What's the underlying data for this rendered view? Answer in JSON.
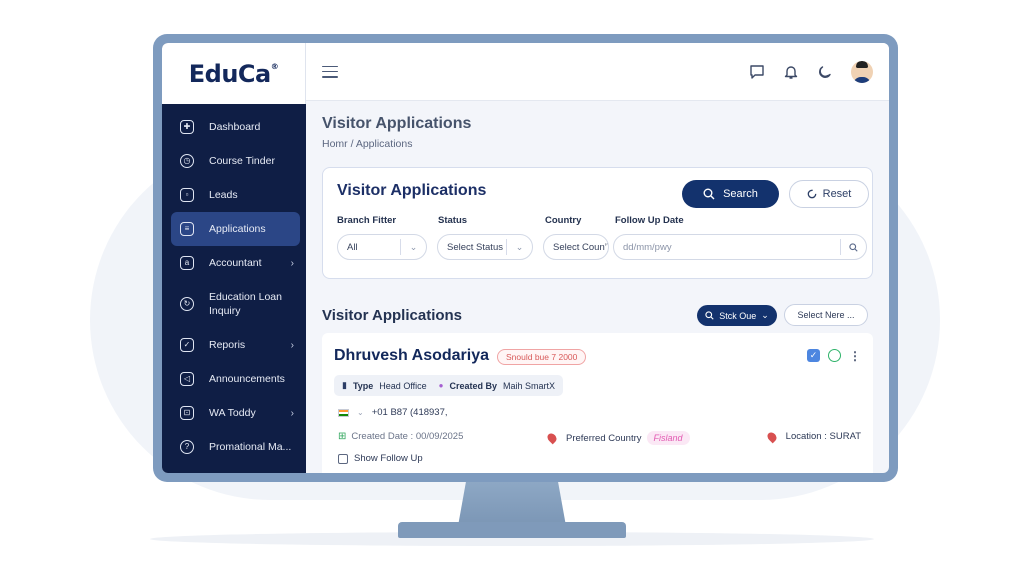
{
  "brand": {
    "logo": "EduCa",
    "logo_mark": "®"
  },
  "sidebar": {
    "items": [
      {
        "label": "Dashboard",
        "icon": "dashboard-icon"
      },
      {
        "label": "Course Tinder",
        "icon": "clock-icon"
      },
      {
        "label": "Leads",
        "icon": "leads-icon"
      },
      {
        "label": "Applications",
        "icon": "applications-icon",
        "active": true
      },
      {
        "label": "Accountant",
        "icon": "accountant-icon",
        "chevron": "›"
      },
      {
        "label": "Education Loan Inquiry",
        "icon": "loan-icon"
      },
      {
        "label": "Reporis",
        "icon": "reports-icon",
        "chevron": "›"
      },
      {
        "label": "Announcements",
        "icon": "megaphone-icon"
      },
      {
        "label": "WA Toddy",
        "icon": "wa-icon",
        "chevron": "›"
      },
      {
        "label": "Promational Ma...",
        "icon": "promotion-icon"
      }
    ]
  },
  "header": {
    "icons": [
      "chat-icon",
      "bell-icon",
      "moon-icon",
      "avatar"
    ]
  },
  "page": {
    "title": "Visitor Applications",
    "breadcrumb": "Homr  /  Applications"
  },
  "filters": {
    "title": "Visitor Applications",
    "search_label": "Search",
    "reset_label": "Reset",
    "branch": {
      "label": "Branch Fitter",
      "value": "All"
    },
    "status": {
      "label": "Status",
      "value": "Select Status"
    },
    "country": {
      "label": "Country",
      "value": "Select Coun’)"
    },
    "follow_up": {
      "label": "Follow Up Date",
      "placeholder": "dd/mm/pwy"
    }
  },
  "list": {
    "title": "Visitor Applications",
    "stck_label": "Stck Oue",
    "select_label": "Select Nere ..."
  },
  "application": {
    "name": "Dhruvesh Asodariya",
    "badge": "Snould bue 7 2000",
    "type_label": "Type",
    "type_value": "Head Office",
    "created_by_label": "Created By",
    "created_by_value": "Maih SmartX",
    "phone": "+01 B87 (418937,",
    "created_date": "Created Date : 00/09/2025",
    "preferred_country_label": "Preferred Country",
    "preferred_country_value": "Fisland",
    "location": "Location :  SURAT",
    "show_follow_up": "Show Follow Up"
  },
  "colors": {
    "sidebar": "#0f1e45",
    "primary": "#13326d",
    "active_nav": "#2b4686",
    "bezel": "#7e9bbf"
  }
}
